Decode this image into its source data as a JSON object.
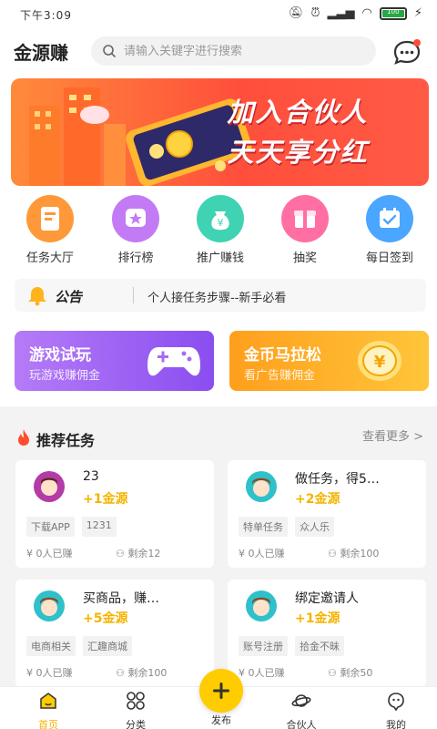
{
  "status_bar": {
    "time": "下午3:09",
    "battery_level": "100"
  },
  "header": {
    "app_title": "金源赚",
    "search_placeholder": "请输入关键字进行搜索"
  },
  "banner": {
    "line1": "加入合伙人",
    "line2": "天天享分红"
  },
  "quick_nav": [
    {
      "label": "任务大厅",
      "icon": "task-hall-icon",
      "color": "#ff9838"
    },
    {
      "label": "排行榜",
      "icon": "ranking-icon",
      "color": "#c27bf5"
    },
    {
      "label": "推广赚钱",
      "icon": "money-bag-icon",
      "color": "#3fd3b3"
    },
    {
      "label": "抽奖",
      "icon": "gift-icon",
      "color": "#ff6fa3"
    },
    {
      "label": "每日签到",
      "icon": "calendar-icon",
      "color": "#4aa6ff"
    }
  ],
  "notice": {
    "title": "公告",
    "text": "个人接任务步骤--新手必看"
  },
  "promos": [
    {
      "title": "游戏试玩",
      "subtitle": "玩游戏赚佣金",
      "icon": "gamepad-icon",
      "color_from": "#b57bf7",
      "color_to": "#8a4ef0"
    },
    {
      "title": "金币马拉松",
      "subtitle": "看广告赚佣金",
      "icon": "coin-icon",
      "color_from": "#ff9f1c",
      "color_to": "#ffc53a"
    }
  ],
  "recommend": {
    "title": "推荐任务",
    "more": "查看更多 >",
    "cards": [
      {
        "name": "23",
        "reward": "+1金源",
        "tags": [
          "下载APP",
          "1231"
        ],
        "earned": "¥ 0人已赚",
        "remain": "剩余12",
        "avatar_color": "#b43aa8"
      },
      {
        "name": "做任务，得5…",
        "reward": "+2金源",
        "tags": [
          "特单任务",
          "众人乐"
        ],
        "earned": "¥ 0人已赚",
        "remain": "剩余100",
        "avatar_color": "#2ec1c9"
      },
      {
        "name": "买商品，赚…",
        "reward": "+5金源",
        "tags": [
          "电商相关",
          "汇趣商城"
        ],
        "earned": "¥ 0人已赚",
        "remain": "剩余100",
        "avatar_color": "#2ec1c9"
      },
      {
        "name": "绑定邀请人",
        "reward": "+1金源",
        "tags": [
          "账号注册",
          "拾金不昧"
        ],
        "earned": "¥ 0人已赚",
        "remain": "剩余50",
        "avatar_color": "#2ec1c9"
      }
    ]
  },
  "tabbar": {
    "home": "首页",
    "category": "分类",
    "publish": "发布",
    "partner": "合伙人",
    "mine": "我的",
    "active_color": "#f4b400"
  }
}
